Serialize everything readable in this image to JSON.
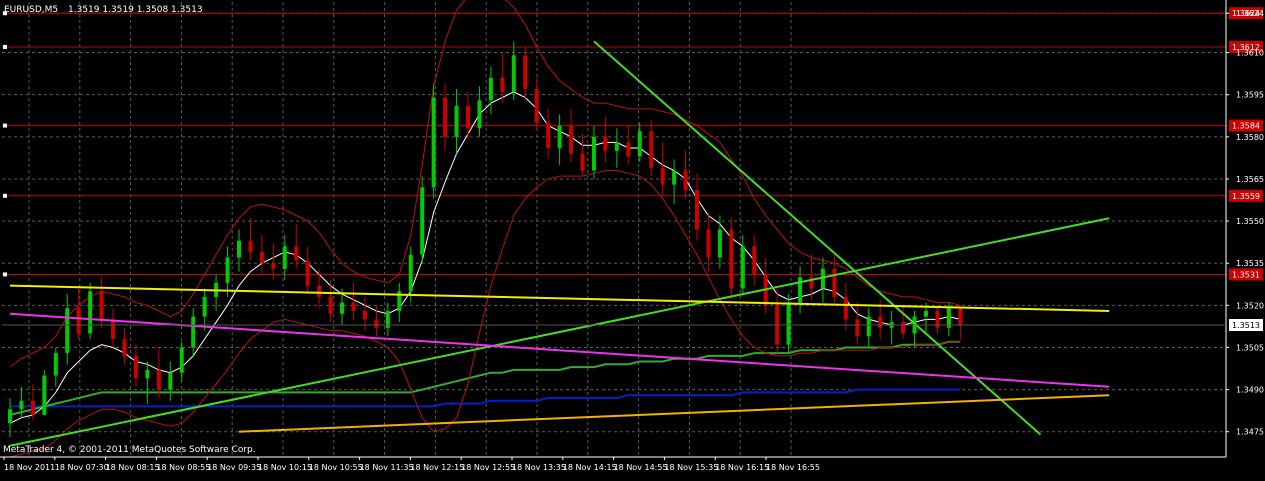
{
  "header": {
    "symbol_label": "EURUSD,M5",
    "ohlc_label": "1.3519 1.3519 1.3508 1.3513"
  },
  "footer": {
    "copyright": "MetaTrader 4, © 2001-2011 MetaQuotes Software Corp."
  },
  "colors": {
    "background": "#000000",
    "grid": "#5a5a5a",
    "axis": "#ffffff",
    "candle_up": "#00cc00",
    "candle_down": "#cc0000",
    "level": "#cc0000",
    "trend_green": "#44dd22",
    "yellow": "#f0f000",
    "magenta": "#ee33ee",
    "blue": "#0022cc",
    "orange": "#f5b000",
    "sma_white": "#ffffff",
    "bands": "#bb1111",
    "ma_green": "#33aa33"
  },
  "chart_data": {
    "type": "candlestick",
    "timeframe": "M5",
    "ylim": [
      1.3466,
      1.3628
    ],
    "grid": true,
    "y_ticks": [
      "1.3475",
      "1.3490",
      "1.3505",
      "1.3520",
      "1.3535",
      "1.3550",
      "1.3565",
      "1.3580",
      "1.3595",
      "1.3610",
      "1.3624"
    ],
    "x_ticks": [
      "18 Nov 2011",
      "18 Nov 07:30",
      "18 Nov 08:15",
      "18 Nov 08:55",
      "18 Nov 09:35",
      "18 Nov 10:15",
      "18 Nov 10:55",
      "18 Nov 11:35",
      "18 Nov 12:15",
      "18 Nov 12:55",
      "18 Nov 13:35",
      "18 Nov 14:15",
      "18 Nov 14:55",
      "18 Nov 15:35",
      "18 Nov 16:15",
      "18 Nov 16:55"
    ],
    "current_price": "1.3513",
    "horizontal_levels": [
      {
        "price": 1.3624,
        "label": "1.3624"
      },
      {
        "price": 1.3612,
        "label": "1.3612"
      },
      {
        "price": 1.3584,
        "label": "1.3584"
      },
      {
        "price": 1.3559,
        "label": "1.3559"
      },
      {
        "price": 1.3531,
        "label": "1.3531"
      }
    ],
    "trend_lines": [
      {
        "name": "green-downtrend",
        "color": "trend_green",
        "points": [
          [
            51.0,
            1.3614
          ],
          [
            90.0,
            1.3474
          ]
        ]
      },
      {
        "name": "green-uptrend",
        "color": "trend_green",
        "points": [
          [
            0.0,
            1.347
          ],
          [
            96.0,
            1.3551
          ]
        ]
      },
      {
        "name": "yellow-line",
        "color": "yellow",
        "points": [
          [
            0.0,
            1.3527
          ],
          [
            96.0,
            1.3518
          ]
        ]
      },
      {
        "name": "magenta-line",
        "color": "magenta",
        "points": [
          [
            0.0,
            1.3517
          ],
          [
            96.0,
            1.3491
          ]
        ]
      },
      {
        "name": "orange-line",
        "color": "orange",
        "points": [
          [
            20.0,
            1.3475
          ],
          [
            96.0,
            1.3488
          ]
        ]
      }
    ],
    "candles": [
      [
        1.3478,
        1.3487,
        1.3473,
        1.3483
      ],
      [
        1.3483,
        1.3491,
        1.348,
        1.3486
      ],
      [
        1.3486,
        1.3492,
        1.3479,
        1.3481
      ],
      [
        1.3481,
        1.3497,
        1.3481,
        1.3495
      ],
      [
        1.3495,
        1.3505,
        1.3491,
        1.3503
      ],
      [
        1.3503,
        1.3524,
        1.3499,
        1.3519
      ],
      [
        1.3519,
        1.3526,
        1.3508,
        1.351
      ],
      [
        1.351,
        1.3528,
        1.3508,
        1.3525
      ],
      [
        1.3525,
        1.353,
        1.3512,
        1.3515
      ],
      [
        1.3515,
        1.3519,
        1.3505,
        1.3508
      ],
      [
        1.3508,
        1.3512,
        1.3499,
        1.3502
      ],
      [
        1.3502,
        1.3506,
        1.3491,
        1.3494
      ],
      [
        1.3494,
        1.35,
        1.3485,
        1.3497
      ],
      [
        1.3497,
        1.3505,
        1.3487,
        1.349
      ],
      [
        1.349,
        1.35,
        1.3486,
        1.3496
      ],
      [
        1.3496,
        1.3507,
        1.3493,
        1.3505
      ],
      [
        1.3505,
        1.3519,
        1.3502,
        1.3516
      ],
      [
        1.3516,
        1.3526,
        1.3511,
        1.3523
      ],
      [
        1.3523,
        1.3531,
        1.3518,
        1.3528
      ],
      [
        1.3528,
        1.3541,
        1.3523,
        1.3537
      ],
      [
        1.3537,
        1.3547,
        1.3532,
        1.3543
      ],
      [
        1.3543,
        1.3551,
        1.3536,
        1.3539
      ],
      [
        1.3539,
        1.3545,
        1.3531,
        1.3535
      ],
      [
        1.3535,
        1.3542,
        1.3529,
        1.3533
      ],
      [
        1.3533,
        1.3545,
        1.3529,
        1.3541
      ],
      [
        1.3541,
        1.3549,
        1.3533,
        1.3536
      ],
      [
        1.3536,
        1.3541,
        1.3524,
        1.3527
      ],
      [
        1.3527,
        1.3533,
        1.3519,
        1.3523
      ],
      [
        1.3523,
        1.3529,
        1.3514,
        1.3517
      ],
      [
        1.3517,
        1.3526,
        1.3513,
        1.3521
      ],
      [
        1.3521,
        1.3528,
        1.3515,
        1.3518
      ],
      [
        1.3518,
        1.3523,
        1.3511,
        1.3515
      ],
      [
        1.3515,
        1.352,
        1.3509,
        1.3512
      ],
      [
        1.3512,
        1.3521,
        1.3509,
        1.3518
      ],
      [
        1.3518,
        1.3528,
        1.3514,
        1.3525
      ],
      [
        1.3525,
        1.3541,
        1.3521,
        1.3538
      ],
      [
        1.3538,
        1.3566,
        1.3535,
        1.3562
      ],
      [
        1.3562,
        1.3599,
        1.3558,
        1.3594
      ],
      [
        1.3594,
        1.3599,
        1.3575,
        1.358
      ],
      [
        1.358,
        1.3597,
        1.3574,
        1.3591
      ],
      [
        1.3591,
        1.3596,
        1.3579,
        1.3583
      ],
      [
        1.3583,
        1.3598,
        1.358,
        1.3593
      ],
      [
        1.3593,
        1.3605,
        1.3588,
        1.3601
      ],
      [
        1.3601,
        1.361,
        1.3592,
        1.3596
      ],
      [
        1.3596,
        1.3614,
        1.3593,
        1.3609
      ],
      [
        1.3609,
        1.3612,
        1.3593,
        1.3597
      ],
      [
        1.3597,
        1.3601,
        1.3582,
        1.3585
      ],
      [
        1.3585,
        1.359,
        1.3572,
        1.3576
      ],
      [
        1.3576,
        1.3588,
        1.357,
        1.3584
      ],
      [
        1.3584,
        1.359,
        1.3571,
        1.3574
      ],
      [
        1.3574,
        1.3581,
        1.3566,
        1.3568
      ],
      [
        1.3568,
        1.3584,
        1.3565,
        1.358
      ],
      [
        1.358,
        1.3587,
        1.3571,
        1.3575
      ],
      [
        1.3575,
        1.3583,
        1.3569,
        1.3578
      ],
      [
        1.3578,
        1.3584,
        1.357,
        1.3573
      ],
      [
        1.3573,
        1.3585,
        1.3571,
        1.3582
      ],
      [
        1.3582,
        1.3586,
        1.3566,
        1.3569
      ],
      [
        1.3569,
        1.3578,
        1.3559,
        1.3563
      ],
      [
        1.3563,
        1.3572,
        1.3556,
        1.3568
      ],
      [
        1.3568,
        1.3575,
        1.3558,
        1.3561
      ],
      [
        1.3561,
        1.3567,
        1.3543,
        1.3547
      ],
      [
        1.3547,
        1.3553,
        1.3532,
        1.3537
      ],
      [
        1.3537,
        1.3552,
        1.3533,
        1.3547
      ],
      [
        1.3547,
        1.3551,
        1.3522,
        1.3526
      ],
      [
        1.3526,
        1.3545,
        1.3524,
        1.3541
      ],
      [
        1.3541,
        1.3545,
        1.3527,
        1.3531
      ],
      [
        1.3531,
        1.3537,
        1.3517,
        1.352
      ],
      [
        1.352,
        1.3526,
        1.3503,
        1.3506
      ],
      [
        1.3506,
        1.3524,
        1.3503,
        1.3521
      ],
      [
        1.3521,
        1.3534,
        1.3517,
        1.353
      ],
      [
        1.353,
        1.3538,
        1.3522,
        1.3526
      ],
      [
        1.3526,
        1.3537,
        1.3521,
        1.3533
      ],
      [
        1.3533,
        1.3538,
        1.352,
        1.3523
      ],
      [
        1.3523,
        1.3528,
        1.3511,
        1.3515
      ],
      [
        1.3515,
        1.3521,
        1.3506,
        1.3509
      ],
      [
        1.3509,
        1.3519,
        1.3505,
        1.3516
      ],
      [
        1.3516,
        1.3522,
        1.3508,
        1.3512
      ],
      [
        1.3512,
        1.3518,
        1.3506,
        1.3514
      ],
      [
        1.3514,
        1.352,
        1.3508,
        1.351
      ],
      [
        1.351,
        1.3518,
        1.3505,
        1.3516
      ],
      [
        1.3516,
        1.3521,
        1.351,
        1.3518
      ],
      [
        1.3518,
        1.352,
        1.351,
        1.3512
      ],
      [
        1.3512,
        1.3521,
        1.3509,
        1.3519
      ],
      [
        1.3519,
        1.3519,
        1.3508,
        1.3513
      ]
    ],
    "indicators": {
      "sma_white": [
        1.3478,
        1.348,
        1.3481,
        1.3484,
        1.3489,
        1.3496,
        1.35,
        1.3504,
        1.3506,
        1.3505,
        1.3503,
        1.35,
        1.3499,
        1.3497,
        1.3496,
        1.3498,
        1.3502,
        1.3508,
        1.3514,
        1.352,
        1.3527,
        1.3532,
        1.3535,
        1.3537,
        1.3539,
        1.3538,
        1.3535,
        1.3531,
        1.3527,
        1.3524,
        1.3522,
        1.352,
        1.3518,
        1.3517,
        1.3519,
        1.3525,
        1.3536,
        1.3553,
        1.3564,
        1.3574,
        1.3581,
        1.3588,
        1.3592,
        1.3594,
        1.3596,
        1.3594,
        1.359,
        1.3584,
        1.3582,
        1.358,
        1.3577,
        1.3577,
        1.3578,
        1.3578,
        1.3576,
        1.3576,
        1.3573,
        1.357,
        1.3568,
        1.3565,
        1.3558,
        1.3552,
        1.3549,
        1.3544,
        1.3541,
        1.3536,
        1.353,
        1.3524,
        1.3522,
        1.3523,
        1.3524,
        1.3526,
        1.3525,
        1.3522,
        1.3517,
        1.3515,
        1.3514,
        1.3513,
        1.3513,
        1.3514,
        1.3515,
        1.3515,
        1.3516,
        1.3515
      ],
      "bands_upper": [
        1.3498,
        1.3501,
        1.3503,
        1.3505,
        1.3509,
        1.3516,
        1.352,
        1.3523,
        1.3525,
        1.3524,
        1.3523,
        1.3521,
        1.352,
        1.3518,
        1.3516,
        1.3518,
        1.3524,
        1.3531,
        1.3538,
        1.3545,
        1.3551,
        1.3555,
        1.3556,
        1.3555,
        1.3554,
        1.3552,
        1.355,
        1.3546,
        1.354,
        1.3535,
        1.3532,
        1.353,
        1.3529,
        1.3528,
        1.3531,
        1.3545,
        1.357,
        1.3598,
        1.3614,
        1.3625,
        1.363,
        1.3633,
        1.3632,
        1.363,
        1.3626,
        1.362,
        1.3612,
        1.3605,
        1.36,
        1.3597,
        1.3594,
        1.3592,
        1.3592,
        1.3591,
        1.359,
        1.359,
        1.359,
        1.3589,
        1.3588,
        1.3586,
        1.3584,
        1.3581,
        1.3578,
        1.3572,
        1.3566,
        1.3558,
        1.3552,
        1.3547,
        1.3542,
        1.3539,
        1.3537,
        1.3536,
        1.3535,
        1.3533,
        1.353,
        1.3527,
        1.3525,
        1.3524,
        1.3523,
        1.3523,
        1.3522,
        1.3521,
        1.3521,
        1.352
      ],
      "bands_lower": [
        1.3466,
        1.3467,
        1.3468,
        1.3469,
        1.3472,
        1.3476,
        1.3479,
        1.3481,
        1.3483,
        1.3483,
        1.3482,
        1.348,
        1.3479,
        1.3478,
        1.3477,
        1.3478,
        1.3482,
        1.3487,
        1.3492,
        1.3497,
        1.3503,
        1.3508,
        1.3511,
        1.3514,
        1.3515,
        1.3514,
        1.3513,
        1.3512,
        1.3511,
        1.3511,
        1.351,
        1.3509,
        1.3507,
        1.3505,
        1.35,
        1.349,
        1.348,
        1.3475,
        1.3476,
        1.348,
        1.3492,
        1.351,
        1.3527,
        1.354,
        1.3552,
        1.3558,
        1.3562,
        1.3565,
        1.3566,
        1.3566,
        1.3566,
        1.3567,
        1.3568,
        1.3568,
        1.3567,
        1.3566,
        1.3563,
        1.3558,
        1.3552,
        1.3545,
        1.3538,
        1.353,
        1.3522,
        1.3515,
        1.3509,
        1.3505,
        1.3503,
        1.3502,
        1.3502,
        1.3503,
        1.3503,
        1.3504,
        1.3504,
        1.3504,
        1.3504,
        1.3504,
        1.3505,
        1.3505,
        1.3505,
        1.3506,
        1.3506,
        1.3506,
        1.3507,
        1.3507
      ],
      "ma_green": [
        1.3481,
        1.3482,
        1.3483,
        1.3484,
        1.3485,
        1.3486,
        1.3487,
        1.3488,
        1.3489,
        1.3489,
        1.3489,
        1.3489,
        1.3489,
        1.3489,
        1.3489,
        1.3489,
        1.3489,
        1.3489,
        1.3489,
        1.3489,
        1.3489,
        1.3489,
        1.3489,
        1.3489,
        1.3489,
        1.3489,
        1.3489,
        1.3489,
        1.3489,
        1.3489,
        1.3489,
        1.3489,
        1.3489,
        1.3489,
        1.3489,
        1.3489,
        1.349,
        1.3491,
        1.3492,
        1.3493,
        1.3494,
        1.3495,
        1.3496,
        1.3496,
        1.3497,
        1.3497,
        1.3497,
        1.3497,
        1.3497,
        1.3498,
        1.3498,
        1.3498,
        1.3499,
        1.3499,
        1.3499,
        1.35,
        1.35,
        1.35,
        1.3501,
        1.3501,
        1.3501,
        1.3502,
        1.3502,
        1.3502,
        1.3502,
        1.3503,
        1.3503,
        1.3503,
        1.3503,
        1.3504,
        1.3504,
        1.3504,
        1.3504,
        1.3505,
        1.3505,
        1.3505,
        1.3505,
        1.3505,
        1.3506,
        1.3506,
        1.3506,
        1.3506,
        1.3507,
        1.3507
      ],
      "ma_blue": [
        1.3484,
        1.3484,
        1.3484,
        1.3484,
        1.3484,
        1.3484,
        1.3484,
        1.3484,
        1.3484,
        1.3484,
        1.3484,
        1.3484,
        1.3484,
        1.3484,
        1.3484,
        1.3484,
        1.3484,
        1.3484,
        1.3484,
        1.3484,
        1.3484,
        1.3484,
        1.3484,
        1.3484,
        1.3484,
        1.3484,
        1.3484,
        1.3484,
        1.3484,
        1.3484,
        1.3484,
        1.3484,
        1.3484,
        1.3484,
        1.3484,
        1.3484,
        1.3484,
        1.3484,
        1.3485,
        1.3485,
        1.3485,
        1.3485,
        1.3486,
        1.3486,
        1.3486,
        1.3486,
        1.3486,
        1.3487,
        1.3487,
        1.3487,
        1.3487,
        1.3487,
        1.3487,
        1.3487,
        1.3488,
        1.3488,
        1.3488,
        1.3488,
        1.3488,
        1.3488,
        1.3488,
        1.3488,
        1.3488,
        1.3488,
        1.3489,
        1.3489,
        1.3489,
        1.3489,
        1.3489,
        1.3489,
        1.3489,
        1.3489,
        1.3489,
        1.3489,
        1.349,
        1.349,
        1.349,
        1.349,
        1.349,
        1.349,
        1.349,
        1.349,
        1.349,
        1.349
      ]
    }
  }
}
